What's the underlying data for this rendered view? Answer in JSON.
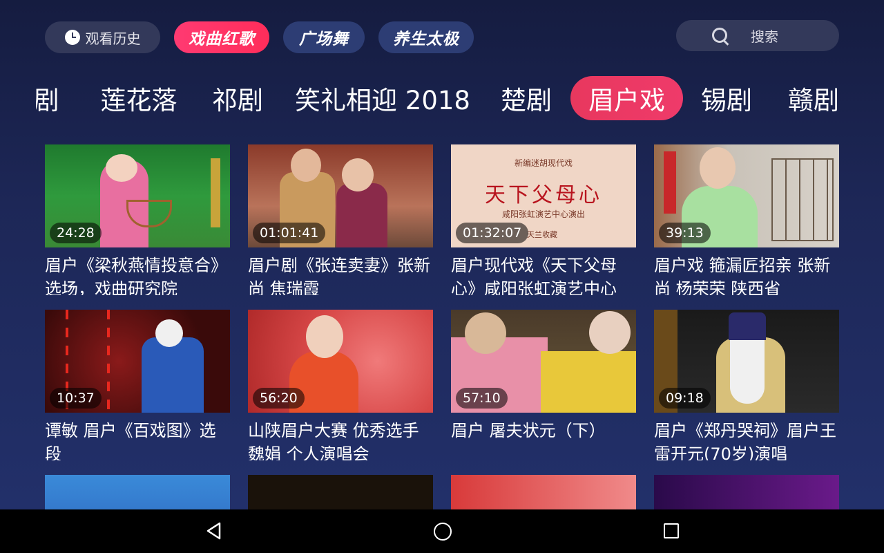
{
  "header": {
    "history_label": "观看历史",
    "categories": [
      "戏曲红歌",
      "广场舞",
      "养生太极"
    ],
    "active_category": "戏曲红歌",
    "search_placeholder": "搜索"
  },
  "genres": [
    "剧",
    "莲花落",
    "祁剧",
    "笑礼相迎 2018",
    "楚剧",
    "眉户戏",
    "锡剧",
    "赣剧"
  ],
  "active_genre": "眉户戏",
  "videos": [
    {
      "title": "眉户《梁秋燕情投意合》选场，戏曲研究院",
      "duration": "24:28"
    },
    {
      "title": "眉户剧《张连卖妻》张新尚 焦瑞霞",
      "duration": "01:01:41"
    },
    {
      "title": "眉户现代戏《天下父母心》咸阳张虹演艺中心",
      "duration": "01:32:07"
    },
    {
      "title": "眉户戏 箍漏匠招亲 张新尚 杨荣荣 陕西省",
      "duration": "39:13"
    },
    {
      "title": "谭敏 眉户《百戏图》选段",
      "duration": "10:37"
    },
    {
      "title": "山陕眉户大赛 优秀选手 魏娟 个人演唱会",
      "duration": "56:20"
    },
    {
      "title": "眉户  屠夫状元（下）",
      "duration": "57:10"
    },
    {
      "title": "眉户《郑丹哭祠》眉户王雷开元(70岁)演唱",
      "duration": "09:18"
    },
    {
      "title": "",
      "duration": ""
    },
    {
      "title": "",
      "duration": ""
    },
    {
      "title": "",
      "duration": ""
    },
    {
      "title": "",
      "duration": ""
    }
  ],
  "thumb_overlays": {
    "t3_line1": "新编迷胡现代戏",
    "t3_main": "天下父母心",
    "t3_line3": "咸阳张虹演艺中心演出",
    "t3_line4": "天兰收藏"
  },
  "navbar": {
    "back": "back-icon",
    "home": "home-icon",
    "recents": "recents-icon"
  }
}
